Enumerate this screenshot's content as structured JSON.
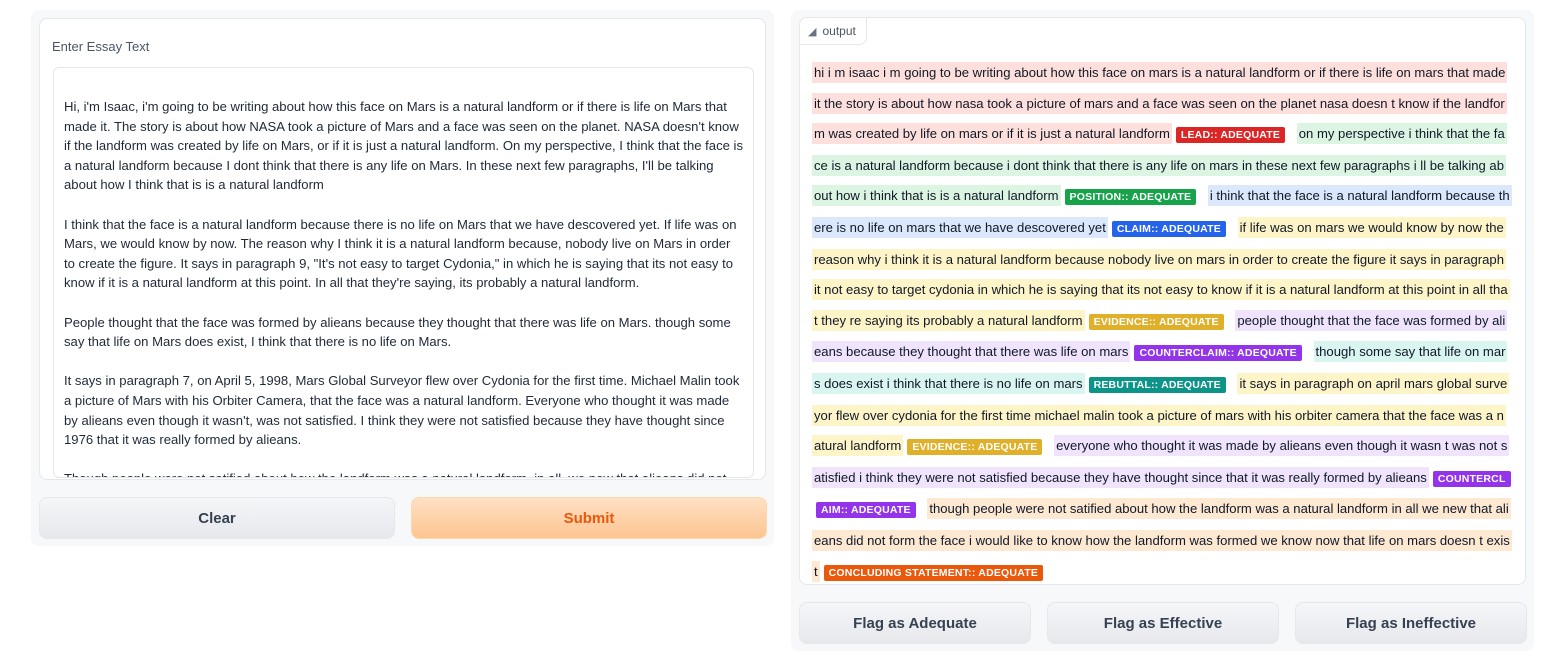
{
  "input": {
    "label": "Enter Essay Text",
    "paragraphs": [
      "Hi, i'm Isaac, i'm going to be writing about how this face on Mars is a natural landform or if there is life on Mars that made it. The story is about how NASA took a picture of Mars and a face was seen on the planet. NASA doesn't know if the landform was created by life on Mars, or if it is just a natural landform. On my perspective, I think that the face is a natural landform because I dont think that there is any life on Mars. In these next few paragraphs, I'll be talking about how I think that is is a natural landform",
      "I think that the face is a natural landform because there is no life on Mars that we have descovered yet. If life was on Mars, we would know by now. The reason why I think it is a natural landform because, nobody live on Mars in order to create the figure. It says in paragraph 9, \"It's not easy to target Cydonia,\" in which he is saying that its not easy to know if it is a natural landform at this point. In all that they're saying, its probably a natural landform.",
      "People thought that the face was formed by alieans because they thought that there was life on Mars. though some say that life on Mars does exist, I think that there is no life on Mars.",
      "It says in paragraph 7, on April 5, 1998, Mars Global Surveyor flew over Cydonia for the first time. Michael Malin took a picture of Mars with his Orbiter Camera, that the face was a natural landform. Everyone who thought it was made by alieans even though it wasn't, was not satisfied. I think they were not satisfied because they have thought since 1976 that it was really formed by alieans.",
      "Though people were not satified about how the landform was a natural landform, in all, we new that alieans did not form the face. I would like to know how the landform was formed. We know now that life on Mars doesn't exist."
    ]
  },
  "buttons": {
    "clear": "Clear",
    "submit": "Submit"
  },
  "output": {
    "tag": "output",
    "segments": [
      {
        "text": "hi i m isaac i m going to be writing about how this face on mars is a natural landform or if there is life on mars that made it the story is about how nasa took a picture of mars and a face was seen on the planet nasa doesn t know if the landform was created by life on mars or if it is just a natural landform",
        "label": "LEAD:: ADEQUATE",
        "bg": "#fde0dc",
        "tag_color": "#dc2626"
      },
      {
        "text": "on my perspective i think that the face is a natural landform because i dont think that there is any life on mars in these next few paragraphs i ll be talking about how i think that is is a natural landform",
        "label": "POSITION:: ADEQUATE",
        "bg": "#dcf5e3",
        "tag_color": "#16a34a"
      },
      {
        "text": "i think that the face is a natural landform because there is no life on mars that we have descovered yet",
        "label": "CLAIM:: ADEQUATE",
        "bg": "#dbe7fb",
        "tag_color": "#2563eb"
      },
      {
        "text": "if life was on mars we would know by now the reason why i think it is a natural landform because nobody live on mars in order to create the figure it says in paragraph it not easy to target cydonia in which he is saying that its not easy to know if it is a natural landform at this point in all that they re saying its probably a natural landform",
        "label": "EVIDENCE:: ADEQUATE",
        "bg": "#fdf4c8",
        "tag_color": "#e0b02a"
      },
      {
        "text": "people thought that the face was formed by alieans because they thought that there was life on mars",
        "label": "COUNTERCLAIM:: ADEQUATE",
        "bg": "#efe4fb",
        "tag_color": "#9333ea"
      },
      {
        "text": "though some say that life on mars does exist i think that there is no life on mars",
        "label": "REBUTTAL:: ADEQUATE",
        "bg": "#d8f5ef",
        "tag_color": "#0d9488"
      },
      {
        "text": "it says in paragraph on april mars global surveyor flew over cydonia for the first time michael malin took a picture of mars with his orbiter camera that the face was a natural landform",
        "label": "EVIDENCE:: ADEQUATE",
        "bg": "#fdf4c8",
        "tag_color": "#e0b02a"
      },
      {
        "text": "everyone who thought it was made by alieans even though it wasn t was not satisfied i think they were not satisfied because they have thought since that it was really formed by alieans",
        "label": "COUNTERCLAIM:: ADEQUATE",
        "bg": "#efe4fb",
        "tag_color": "#9333ea"
      },
      {
        "text": "though people were not satified about how the landform was a natural landform in all we new that alieans did not form the face i would like to know how the landform was formed we know now that life on mars doesn t exist",
        "label": "CONCLUDING STATEMENT:: ADEQUATE",
        "bg": "#fde8d2",
        "tag_color": "#ea580c"
      }
    ]
  },
  "flags": {
    "adequate": "Flag as Adequate",
    "effective": "Flag as Effective",
    "ineffective": "Flag as Ineffective"
  }
}
